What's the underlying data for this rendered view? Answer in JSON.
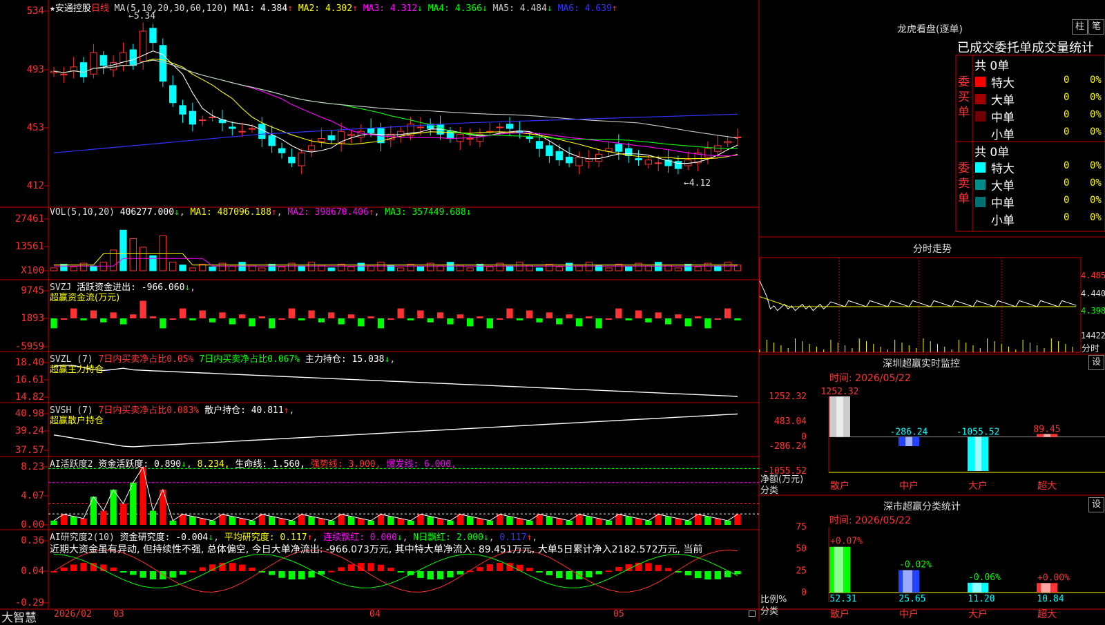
{
  "app": {
    "brand": "大智慧"
  },
  "main_chart": {
    "stock_name": "★安通控股",
    "period": "日线",
    "ma_header": "MA(5,10,20,30,60,120)",
    "ma_values": [
      {
        "label": "MA1:",
        "value": "4.384",
        "arrow": "↑",
        "color": "#ffffff"
      },
      {
        "label": "MA2:",
        "value": "4.302",
        "arrow": "↑",
        "color": "#ffff00"
      },
      {
        "label": "MA3:",
        "value": "4.312",
        "arrow": "↓",
        "color": "#ff00ff"
      },
      {
        "label": "MA4:",
        "value": "4.366",
        "arrow": "↓",
        "color": "#00ff00"
      },
      {
        "label": "MA5:",
        "value": "4.484",
        "arrow": "↓",
        "color": "#cccccc"
      },
      {
        "label": "MA6:",
        "value": "4.639",
        "arrow": "↑",
        "color": "#3333ff"
      }
    ],
    "high_label": "5.34",
    "low_label": "4.12",
    "y_ticks": [
      "534",
      "493",
      "453",
      "412"
    ],
    "x_labels": [
      "2026/02",
      "03",
      "04",
      "05"
    ]
  },
  "vol_panel": {
    "header": "VOL(5,10,20)",
    "value": "406277.000",
    "ma1": "MA1: 487096.188",
    "ma2": "MA2: 398670.406",
    "ma3": "MA3: 357449.688",
    "y_ticks": [
      "27461",
      "13561",
      "X100"
    ]
  },
  "svzj_panel": {
    "header": "SVZJ",
    "label": "活跃资金进出: -966.060",
    "subtitle": "超赢资金流(万元)",
    "y_ticks": [
      "9745",
      "1893",
      "-5959"
    ]
  },
  "svzl_panel": {
    "header": "SVZL (7)",
    "text1": "7日内买卖净占比0.05%",
    "text2": "7日内买卖净占比0.067%",
    "text3": "主力持仓: 15.038",
    "subtitle": "超赢主力持仓",
    "y_ticks": [
      "18.40",
      "16.61",
      "14.82"
    ]
  },
  "svsh_panel": {
    "header": "SVSH (7)",
    "text1": "7日内买卖净占比0.083%",
    "text2": "散户持仓: 40.811",
    "subtitle": "超赢散户持仓",
    "y_ticks": [
      "40.98",
      "39.24",
      "37.57"
    ]
  },
  "ai_active_panel": {
    "header": "AI活跃度2",
    "t1": "资金活跃度: 0.890",
    "t2": "8.234,",
    "t3": "生命线: 1.560,",
    "t4": "强势线: 3.000,",
    "t5": "爆发线: 6.000,",
    "y_ticks": [
      "8.23",
      "4.07",
      "0.00"
    ]
  },
  "ai_research_panel": {
    "header": "AI研究度2(10)",
    "t1": "资金研究度: -0.004",
    "t2": "平均研究度: 0.117",
    "t3": "连续飘红: 0.000",
    "t4": "N日飘红: 2.000",
    "t5": "0.117",
    "comment": "近期大资金虽有异动, 但持续性不强, 总体偏空, 今日大单净流出: -966.073万元, 其中特大单净流入: 89.451万元, 大单5日累计净入2182.572万元, 当前",
    "y_ticks": [
      "0.36",
      "0.04",
      "-0.29"
    ]
  },
  "right": {
    "lhb_title": "龙虎看盘(逐单)",
    "btn_zhu": "柱",
    "btn_bi": "笔",
    "order_title": "已成交委托单成交量统计",
    "buy_side": "委买单",
    "sell_side": "委卖单",
    "buy_total": "共 0单",
    "sell_total": "共 0单",
    "buy_rows": [
      {
        "label": "特大",
        "count": "0",
        "pct": "0%",
        "color": "#ff0000"
      },
      {
        "label": "大单",
        "count": "0",
        "pct": "0%",
        "color": "#a00000"
      },
      {
        "label": "中单",
        "count": "0",
        "pct": "0%",
        "color": "#700000"
      },
      {
        "label": "小单",
        "count": "0",
        "pct": "0%",
        "color": "#000000"
      }
    ],
    "sell_rows": [
      {
        "label": "特大",
        "count": "0",
        "pct": "0%",
        "color": "#00ffff"
      },
      {
        "label": "大单",
        "count": "0",
        "pct": "0%",
        "color": "#008b8b"
      },
      {
        "label": "中单",
        "count": "0",
        "pct": "0%",
        "color": "#007070"
      },
      {
        "label": "小单",
        "count": "0",
        "pct": "0%",
        "color": "#000000"
      }
    ],
    "intraday_title": "分时走势",
    "intraday_prices": [
      "4.485",
      "4.440",
      "4.398"
    ],
    "intraday_vol": "14422",
    "intraday_btn": "分时",
    "sz_monitor_title": "深圳超赢实时监控",
    "sz_time": "时间: 2026/05/22",
    "set_btn": "设",
    "monitor_y": [
      "1252.32",
      "483.04",
      "0",
      "-286.24",
      "-1055.52"
    ],
    "monitor_yaxis_label": "净额(万元)",
    "monitor_xaxis_label": "分类",
    "classify_title": "深市超赢分类统计",
    "classify_time": "时间: 2026/05/22",
    "classify_y": [
      "75",
      "50",
      "25",
      "0"
    ],
    "classify_yaxis_label": "比例%",
    "classify_xaxis_label": "分类"
  },
  "chart_data": [
    {
      "type": "bar",
      "title": "深圳超赢实时监控",
      "categories": [
        "散户",
        "中户",
        "大户",
        "超大"
      ],
      "values": [
        1252.32,
        -286.24,
        -1055.52,
        89.45
      ],
      "ylim": [
        -1055.52,
        1252.32
      ]
    },
    {
      "type": "bar",
      "title": "深市超赢分类统计",
      "categories": [
        "散户",
        "中户",
        "大户",
        "超大"
      ],
      "values": [
        52.31,
        25.65,
        11.2,
        10.84
      ],
      "change_labels": [
        "+0.07%",
        "-0.02%",
        "-0.06%",
        "+0.00%"
      ],
      "ylim": [
        0,
        75
      ]
    }
  ]
}
